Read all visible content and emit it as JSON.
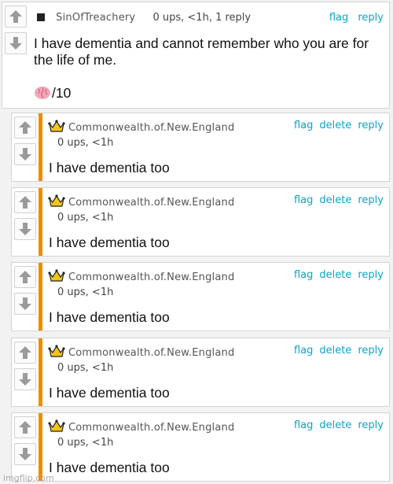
{
  "parent": {
    "username": "SinOfTreachery",
    "meta": "0 ups, <1h, 1 reply",
    "actions": [
      "flag",
      "reply"
    ],
    "text_line1": "I have dementia and cannot remember who you are for",
    "text_line2": "the life of me.",
    "rating_suffix": "/10",
    "rating_icon": "brain-emoji"
  },
  "replies": [
    {
      "username": "Commonwealth.of.New.England",
      "meta": "0 ups, <1h",
      "actions": [
        "flag",
        "delete",
        "reply"
      ],
      "text": "I have dementia too",
      "badge_icon": "crown-icon"
    },
    {
      "username": "Commonwealth.of.New.England",
      "meta": "0 ups, <1h",
      "actions": [
        "flag",
        "delete",
        "reply"
      ],
      "text": "I have dementia too",
      "badge_icon": "crown-icon"
    },
    {
      "username": "Commonwealth.of.New.England",
      "meta": "0 ups, <1h",
      "actions": [
        "flag",
        "delete",
        "reply"
      ],
      "text": "I have dementia too",
      "badge_icon": "crown-icon"
    },
    {
      "username": "Commonwealth.of.New.England",
      "meta": "0 ups, <1h",
      "actions": [
        "flag",
        "delete",
        "reply"
      ],
      "text": "I have dementia too",
      "badge_icon": "crown-icon"
    },
    {
      "username": "Commonwealth.of.New.England",
      "meta": "0 ups, <1h",
      "actions": [
        "flag",
        "delete",
        "reply"
      ],
      "text": "I have dementia too",
      "badge_icon": "crown-icon"
    }
  ],
  "colors": {
    "accent": "#f28b00",
    "link": "#0aa3c9",
    "crown": "#f5c518"
  },
  "watermark": "imgflip.com"
}
